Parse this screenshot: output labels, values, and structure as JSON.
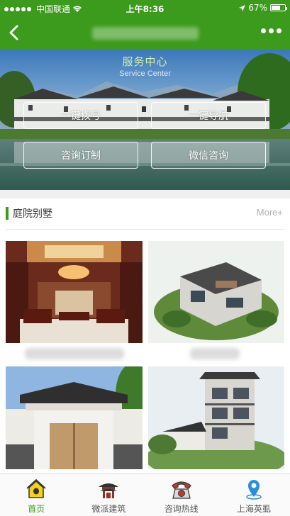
{
  "status_bar": {
    "carrier": "中国联通",
    "time": "上午8:36",
    "battery": "67%",
    "battery_level": 0.67
  },
  "banner": {
    "title": "服务中心",
    "subtitle": "Service Center",
    "buttons": [
      {
        "label": "一键拨号"
      },
      {
        "label": "一键导航"
      },
      {
        "label": "咨询订制"
      },
      {
        "label": "微信咨询"
      }
    ]
  },
  "section": {
    "title": "庭院别墅",
    "more": "More+"
  },
  "tabbar": {
    "items": [
      {
        "label": "首页"
      },
      {
        "label": "微派建筑"
      },
      {
        "label": "咨询热线"
      },
      {
        "label": "上海英虱"
      }
    ]
  },
  "colors": {
    "brand": "#3c9a1c"
  }
}
